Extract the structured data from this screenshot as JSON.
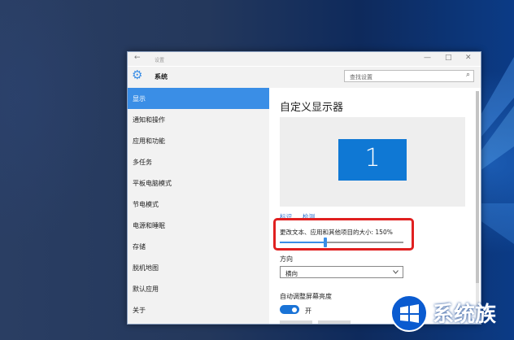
{
  "window": {
    "title": "设置",
    "minimize_glyph": "—",
    "maximize_glyph": "□",
    "close_glyph": "✕",
    "back_glyph": "←"
  },
  "header": {
    "title": "系统",
    "search_placeholder": "查找设置",
    "search_glyph": "⌕",
    "gear_glyph": "⚙"
  },
  "sidebar": {
    "items": [
      {
        "label": "显示"
      },
      {
        "label": "通知和操作"
      },
      {
        "label": "应用和功能"
      },
      {
        "label": "多任务"
      },
      {
        "label": "平板电脑模式"
      },
      {
        "label": "节电模式"
      },
      {
        "label": "电源和睡眠"
      },
      {
        "label": "存储"
      },
      {
        "label": "脱机地图"
      },
      {
        "label": "默认应用"
      },
      {
        "label": "关于"
      }
    ],
    "selected_index": 0
  },
  "main": {
    "heading": "自定义显示器",
    "monitor_number": "1",
    "links": {
      "identify": "标识",
      "detect": "检测"
    },
    "scale": {
      "label": "更改文本、应用和其他项目的大小: 150%",
      "value_percent": 150,
      "slider_fraction": 0.37
    },
    "orientation": {
      "label": "方向",
      "value": "横向"
    },
    "brightness": {
      "label": "自动调整屏幕亮度",
      "toggle_state": "开",
      "on": true
    }
  },
  "watermark": {
    "text": "系统族"
  },
  "colors": {
    "accent": "#3a8ee6",
    "monitor": "#0f78d4",
    "highlight": "#e02020",
    "sidebar_bg": "#f2f2f2"
  }
}
